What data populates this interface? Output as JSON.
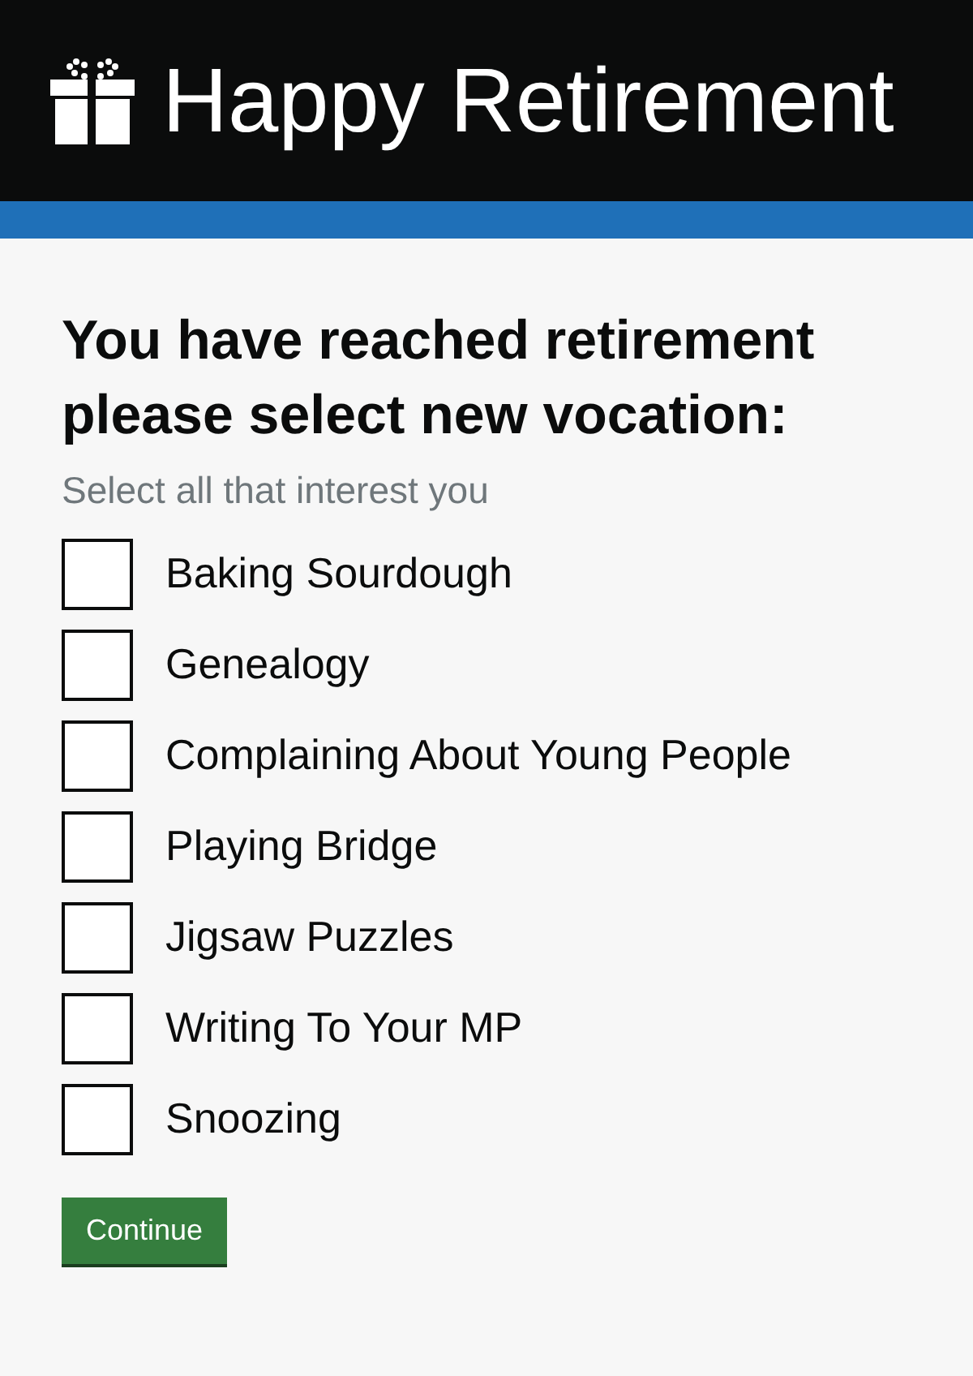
{
  "header": {
    "title": "Happy Retirement"
  },
  "form": {
    "heading": "You have reached retirement please select new vocation:",
    "hint": "Select all that interest you",
    "options": [
      {
        "label": "Baking Sourdough",
        "checked": false
      },
      {
        "label": "Genealogy",
        "checked": false
      },
      {
        "label": "Complaining About Young People",
        "checked": false
      },
      {
        "label": "Playing Bridge",
        "checked": false
      },
      {
        "label": "Jigsaw Puzzles",
        "checked": false
      },
      {
        "label": "Writing To Your MP",
        "checked": false
      },
      {
        "label": "Snoozing",
        "checked": false
      }
    ],
    "button": "Continue"
  }
}
